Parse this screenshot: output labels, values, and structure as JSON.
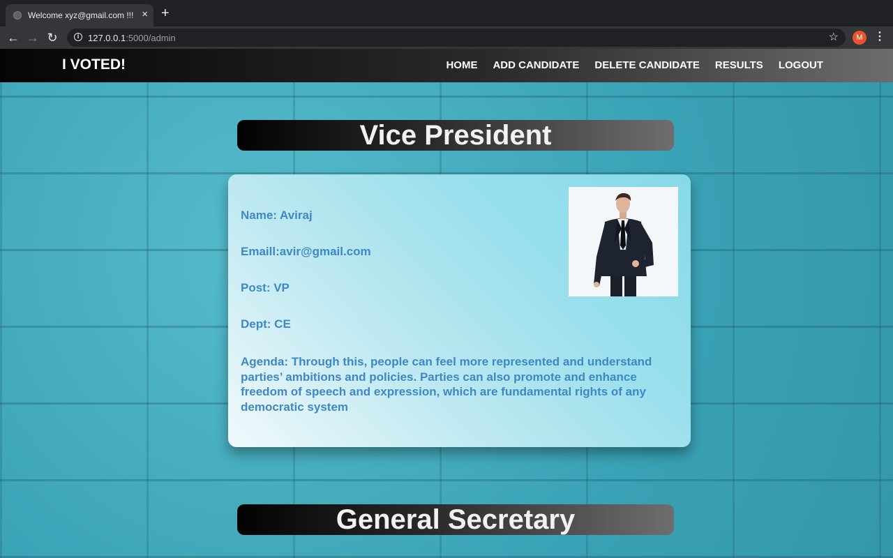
{
  "browser": {
    "tab_title": "Welcome xyz@gmail.com !!!",
    "url_host": "127.0.0.1",
    "url_rest": ":5000/admin",
    "profile_initial": "M"
  },
  "navbar": {
    "brand": "I VOTED!",
    "links": [
      "HOME",
      "ADD CANDIDATE",
      "DELETE CANDIDATE",
      "RESULTS",
      "LOGOUT"
    ]
  },
  "sections": [
    {
      "title": "Vice President",
      "candidate": {
        "name": "Name: Aviraj",
        "email": "Emaill:avir@gmail.com",
        "post": "Post: VP",
        "dept": "Dept: CE",
        "agenda": "Agenda: Through this, people can feel more represented and understand parties’ ambitions and policies. Parties can also promote and enhance freedom of speech and expression, which are fundamental rights of any democratic system"
      }
    },
    {
      "title": "General Secretary"
    }
  ],
  "colors": {
    "field_text": "#3e88c5",
    "page_background": "#3fa8bb",
    "accent_avatar": "#e8522f"
  }
}
